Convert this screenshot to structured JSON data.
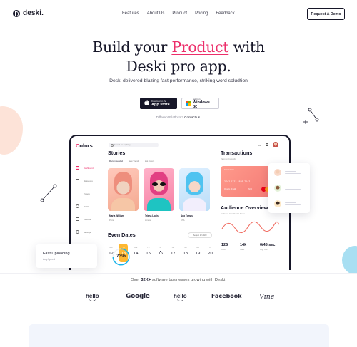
{
  "brand": {
    "name": "deski."
  },
  "nav": {
    "items": [
      "Features",
      "About Us",
      "Product",
      "Pricing",
      "Feedback"
    ],
    "cta": "Request A Demo"
  },
  "hero": {
    "title_pre": "Build your ",
    "title_highlight": "Product",
    "title_post": " with",
    "title_line2": "Deski pro app.",
    "subtitle": "Deski delivered blazing fast performance, striking word soludtion",
    "app_store_small": "Download on the",
    "app_store_big": "App store",
    "windows_small": "Get it on",
    "windows_big": "Windows pc",
    "platform_text": "Different Platform?",
    "platform_link": "Contact us."
  },
  "app": {
    "logo_first": "C",
    "logo_rest": "olors",
    "search_placeholder": "Search for anything...",
    "lang": "EN",
    "sidebar": [
      "Dashboard",
      "Messages",
      "Tickets",
      "Profile",
      "Calendar",
      "Settings"
    ],
    "stories_title": "Stories",
    "tabs": [
      "Recommended",
      "New Trends",
      "Hot Colors"
    ],
    "stories": [
      {
        "name": "Maria William",
        "location": "Paris"
      },
      {
        "name": "Triana Louis",
        "location": "London"
      },
      {
        "name": "Ana Tomas",
        "location": "USA"
      }
    ],
    "events_title": "Even Dates",
    "event_date": "August 12 2020",
    "days": [
      {
        "dw": "Mo",
        "dn": "12"
      },
      {
        "dw": "Tu",
        "dn": "13"
      },
      {
        "dw": "We",
        "dn": "14"
      },
      {
        "dw": "Th",
        "dn": "15"
      },
      {
        "dw": "Fr",
        "dn": "16"
      },
      {
        "dw": "Sa",
        "dn": "17"
      },
      {
        "dw": "Su",
        "dn": "18"
      },
      {
        "dw": "Mo",
        "dn": "19"
      },
      {
        "dw": "Tu",
        "dn": "20"
      }
    ],
    "selected_day_index": 1,
    "dotted_day_index": 4,
    "transactions_title": "Transactions",
    "transactions_sub": "Payment by cards",
    "card": {
      "type": "Credit Card",
      "number": "2742 1122 4895 7642",
      "holder": "Ricardo Rinaldi",
      "expiry": "05/22"
    },
    "audience_title": "Audience Overview",
    "audience_sub": "Audience Growth with Deski",
    "stats": [
      {
        "value": "125",
        "label": "Visits"
      },
      {
        "value": "14k",
        "label": "Users"
      },
      {
        "value": "0/45 sec",
        "label": "Avg. Time"
      }
    ]
  },
  "upload": {
    "title": "Fast Uploading",
    "subtitle": "Avg.Speed",
    "percent": 73,
    "percent_label": "73%"
  },
  "social_proof": {
    "pre": "Over ",
    "count": "32K+",
    "post": " software businesses growing with Deski."
  },
  "brands": [
    "hello",
    "Google",
    "hello",
    "Facebook",
    "Vine"
  ],
  "colors": {
    "accent": "#ec2e6a",
    "dark": "#161628",
    "yellow": "#fdb731",
    "ring": "#16b3e9",
    "card": "#f47b76"
  }
}
